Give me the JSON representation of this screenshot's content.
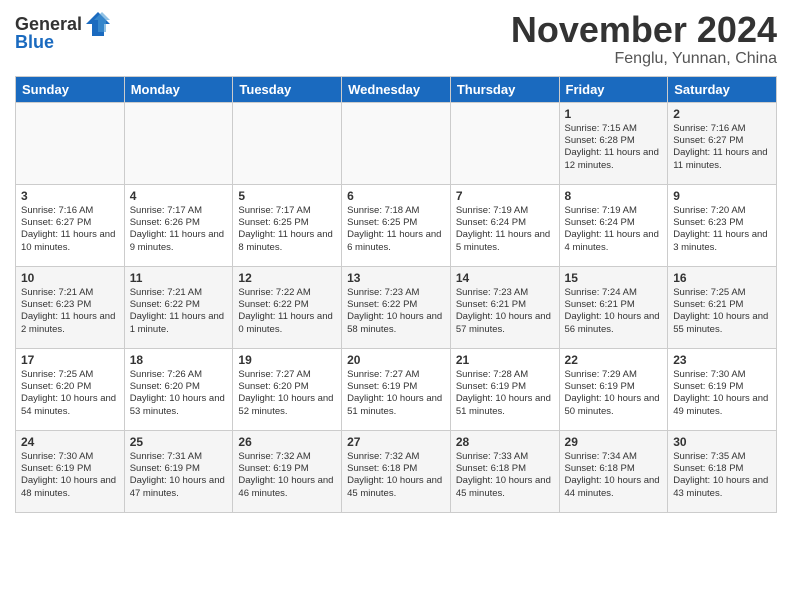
{
  "header": {
    "logo_general": "General",
    "logo_blue": "Blue",
    "month_title": "November 2024",
    "location": "Fenglu, Yunnan, China"
  },
  "days_of_week": [
    "Sunday",
    "Monday",
    "Tuesday",
    "Wednesday",
    "Thursday",
    "Friday",
    "Saturday"
  ],
  "weeks": [
    [
      {
        "day": "",
        "info": ""
      },
      {
        "day": "",
        "info": ""
      },
      {
        "day": "",
        "info": ""
      },
      {
        "day": "",
        "info": ""
      },
      {
        "day": "",
        "info": ""
      },
      {
        "day": "1",
        "info": "Sunrise: 7:15 AM\nSunset: 6:28 PM\nDaylight: 11 hours and 12 minutes."
      },
      {
        "day": "2",
        "info": "Sunrise: 7:16 AM\nSunset: 6:27 PM\nDaylight: 11 hours and 11 minutes."
      }
    ],
    [
      {
        "day": "3",
        "info": "Sunrise: 7:16 AM\nSunset: 6:27 PM\nDaylight: 11 hours and 10 minutes."
      },
      {
        "day": "4",
        "info": "Sunrise: 7:17 AM\nSunset: 6:26 PM\nDaylight: 11 hours and 9 minutes."
      },
      {
        "day": "5",
        "info": "Sunrise: 7:17 AM\nSunset: 6:25 PM\nDaylight: 11 hours and 8 minutes."
      },
      {
        "day": "6",
        "info": "Sunrise: 7:18 AM\nSunset: 6:25 PM\nDaylight: 11 hours and 6 minutes."
      },
      {
        "day": "7",
        "info": "Sunrise: 7:19 AM\nSunset: 6:24 PM\nDaylight: 11 hours and 5 minutes."
      },
      {
        "day": "8",
        "info": "Sunrise: 7:19 AM\nSunset: 6:24 PM\nDaylight: 11 hours and 4 minutes."
      },
      {
        "day": "9",
        "info": "Sunrise: 7:20 AM\nSunset: 6:23 PM\nDaylight: 11 hours and 3 minutes."
      }
    ],
    [
      {
        "day": "10",
        "info": "Sunrise: 7:21 AM\nSunset: 6:23 PM\nDaylight: 11 hours and 2 minutes."
      },
      {
        "day": "11",
        "info": "Sunrise: 7:21 AM\nSunset: 6:22 PM\nDaylight: 11 hours and 1 minute."
      },
      {
        "day": "12",
        "info": "Sunrise: 7:22 AM\nSunset: 6:22 PM\nDaylight: 11 hours and 0 minutes."
      },
      {
        "day": "13",
        "info": "Sunrise: 7:23 AM\nSunset: 6:22 PM\nDaylight: 10 hours and 58 minutes."
      },
      {
        "day": "14",
        "info": "Sunrise: 7:23 AM\nSunset: 6:21 PM\nDaylight: 10 hours and 57 minutes."
      },
      {
        "day": "15",
        "info": "Sunrise: 7:24 AM\nSunset: 6:21 PM\nDaylight: 10 hours and 56 minutes."
      },
      {
        "day": "16",
        "info": "Sunrise: 7:25 AM\nSunset: 6:21 PM\nDaylight: 10 hours and 55 minutes."
      }
    ],
    [
      {
        "day": "17",
        "info": "Sunrise: 7:25 AM\nSunset: 6:20 PM\nDaylight: 10 hours and 54 minutes."
      },
      {
        "day": "18",
        "info": "Sunrise: 7:26 AM\nSunset: 6:20 PM\nDaylight: 10 hours and 53 minutes."
      },
      {
        "day": "19",
        "info": "Sunrise: 7:27 AM\nSunset: 6:20 PM\nDaylight: 10 hours and 52 minutes."
      },
      {
        "day": "20",
        "info": "Sunrise: 7:27 AM\nSunset: 6:19 PM\nDaylight: 10 hours and 51 minutes."
      },
      {
        "day": "21",
        "info": "Sunrise: 7:28 AM\nSunset: 6:19 PM\nDaylight: 10 hours and 51 minutes."
      },
      {
        "day": "22",
        "info": "Sunrise: 7:29 AM\nSunset: 6:19 PM\nDaylight: 10 hours and 50 minutes."
      },
      {
        "day": "23",
        "info": "Sunrise: 7:30 AM\nSunset: 6:19 PM\nDaylight: 10 hours and 49 minutes."
      }
    ],
    [
      {
        "day": "24",
        "info": "Sunrise: 7:30 AM\nSunset: 6:19 PM\nDaylight: 10 hours and 48 minutes."
      },
      {
        "day": "25",
        "info": "Sunrise: 7:31 AM\nSunset: 6:19 PM\nDaylight: 10 hours and 47 minutes."
      },
      {
        "day": "26",
        "info": "Sunrise: 7:32 AM\nSunset: 6:19 PM\nDaylight: 10 hours and 46 minutes."
      },
      {
        "day": "27",
        "info": "Sunrise: 7:32 AM\nSunset: 6:18 PM\nDaylight: 10 hours and 45 minutes."
      },
      {
        "day": "28",
        "info": "Sunrise: 7:33 AM\nSunset: 6:18 PM\nDaylight: 10 hours and 45 minutes."
      },
      {
        "day": "29",
        "info": "Sunrise: 7:34 AM\nSunset: 6:18 PM\nDaylight: 10 hours and 44 minutes."
      },
      {
        "day": "30",
        "info": "Sunrise: 7:35 AM\nSunset: 6:18 PM\nDaylight: 10 hours and 43 minutes."
      }
    ]
  ]
}
